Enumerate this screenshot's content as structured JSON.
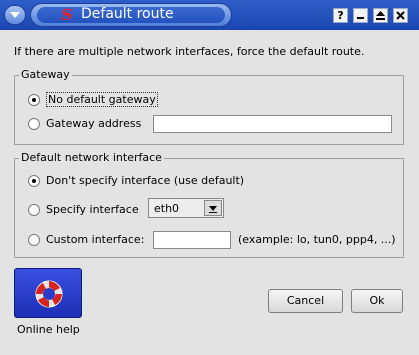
{
  "window": {
    "title": "Default route",
    "app_logo": "S",
    "buttons": {
      "help": "?",
      "minimize": "",
      "maximize": "",
      "close": ""
    }
  },
  "intro_text": "If there are multiple network interfaces, force the default route.",
  "gateway": {
    "legend": "Gateway",
    "no_default_label": "No default gateway",
    "address_label": "Gateway address",
    "address_value": "",
    "selected": "no_default"
  },
  "iface": {
    "legend": "Default network interface",
    "dont_specify_label": "Don't specify interface (use default)",
    "specify_label": "Specify interface",
    "specify_value": "eth0",
    "custom_label": "Custom interface:",
    "custom_value": "",
    "custom_hint": "(example: lo, tun0, ppp4, ...)",
    "selected": "dont_specify"
  },
  "help": {
    "label": "Online help",
    "icon": "lifebuoy-icon"
  },
  "actions": {
    "cancel": "Cancel",
    "ok": "Ok"
  },
  "colors": {
    "titlebar": "#1a46b0",
    "help_tile": "#2a3ccc",
    "background": "#e3e3e3"
  }
}
